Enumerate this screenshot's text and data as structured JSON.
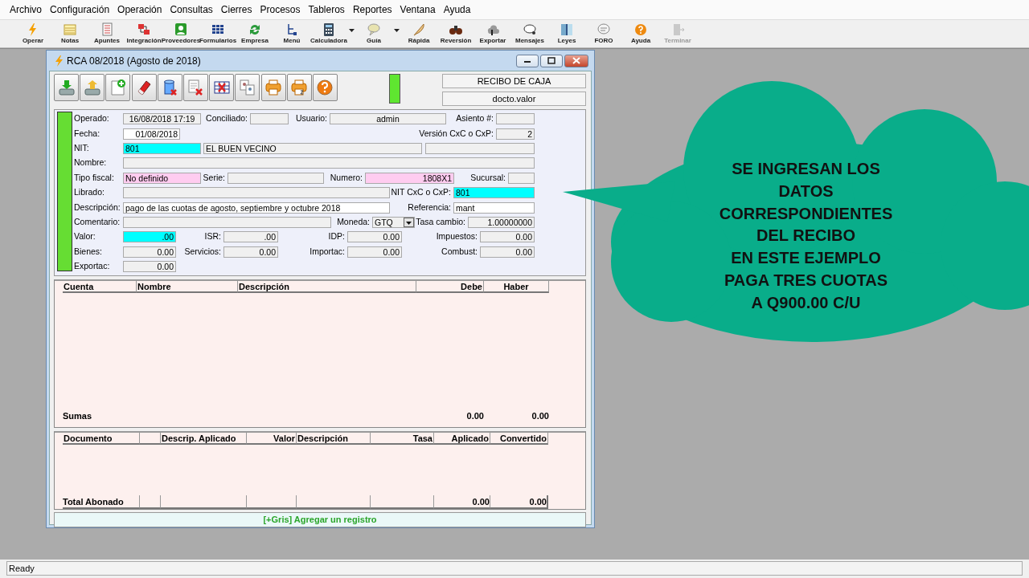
{
  "menu": [
    "Archivo",
    "Configuración",
    "Operación",
    "Consultas",
    "Cierres",
    "Procesos",
    "Tableros",
    "Reportes",
    "Ventana",
    "Ayuda"
  ],
  "toolbar": [
    {
      "label": "Operar",
      "dropdown": false,
      "disabled": false
    },
    {
      "label": "Notas",
      "dropdown": false,
      "disabled": false
    },
    {
      "label": "Apuntes",
      "dropdown": false,
      "disabled": false
    },
    {
      "label": "Integración",
      "dropdown": false,
      "disabled": false
    },
    {
      "label": "Proveedores",
      "dropdown": false,
      "disabled": false
    },
    {
      "label": "Formularios",
      "dropdown": false,
      "disabled": false
    },
    {
      "label": "Empresa",
      "dropdown": false,
      "disabled": false
    },
    {
      "label": "Menú",
      "dropdown": false,
      "disabled": false
    },
    {
      "label": "Calculadora",
      "dropdown": true,
      "disabled": false
    },
    {
      "label": "Guía",
      "dropdown": true,
      "disabled": false
    },
    {
      "label": "Rápida",
      "dropdown": false,
      "disabled": false
    },
    {
      "label": "Reversión",
      "dropdown": false,
      "disabled": false
    },
    {
      "label": "Exportar",
      "dropdown": false,
      "disabled": false
    },
    {
      "label": "Mensajes",
      "dropdown": false,
      "disabled": false
    },
    {
      "label": "Leyes",
      "dropdown": false,
      "disabled": false
    },
    {
      "label": "FORO",
      "dropdown": false,
      "disabled": false
    },
    {
      "label": "Ayuda",
      "dropdown": false,
      "disabled": false
    },
    {
      "label": "Terminar",
      "dropdown": false,
      "disabled": true
    }
  ],
  "window": {
    "title": "RCA 08/2018 (Agosto de 2018)",
    "doc_type": "RECIBO DE CAJA",
    "doc_mode": "docto.valor"
  },
  "form": {
    "fields": [
      {
        "label": "Operado:",
        "value": "16/08/2018 17:19",
        "kind": "center",
        "color": "#f0f0f0"
      },
      {
        "label": "Conciliado:",
        "kind": "text",
        "color": "#f0f0f0"
      },
      {
        "label": "Usuario:",
        "value": "admin",
        "kind": "center",
        "color": "#f0f0f0"
      },
      {
        "label": "Asiento #:",
        "kind": "text",
        "color": "#f0f0f0"
      },
      {
        "label": "Fecha:",
        "value": "01/08/2018",
        "kind": "number",
        "color": "#ffffff"
      },
      {
        "label": "Versión CxC o CxP:",
        "value": "2",
        "kind": "number",
        "color": "#f0f0f0"
      },
      {
        "label": "NIT:",
        "value": "801",
        "kind": "text",
        "color": "#00ffff"
      },
      {
        "value": "EL BUEN VECINO",
        "kind": "text",
        "color": "#f0f0f0"
      },
      {
        "kind": "text",
        "color": "#f0f0f0"
      },
      {
        "label": "Nombre:",
        "kind": "text",
        "color": "#f0f0f0"
      },
      {
        "label": "Tipo fiscal:",
        "value": "No definido",
        "kind": "text",
        "color": "#ffccf0"
      },
      {
        "label": "Serie:",
        "kind": "text",
        "color": "#f0f0f0"
      },
      {
        "label": "Numero:",
        "value": "1808X1",
        "kind": "number",
        "color": "#ffccf0"
      },
      {
        "label": "Sucursal:",
        "kind": "text",
        "color": "#f0f0f0"
      },
      {
        "label": "Librado:",
        "kind": "text",
        "color": "#f0f0f0"
      },
      {
        "label": "NIT CxC o CxP:",
        "value": "801",
        "kind": "text",
        "color": "#00ffff"
      },
      {
        "label": "Descripción:",
        "value": "pago de las cuotas de agosto, septiembre y octubre 2018",
        "kind": "text",
        "color": "#ffffff"
      },
      {
        "label": "Referencia:",
        "value": "mant",
        "kind": "text",
        "color": "#ffffff"
      },
      {
        "label": "Comentario:",
        "kind": "text",
        "color": "#f0f0f0"
      },
      {
        "label": "Moneda:",
        "value": "GTQ",
        "kind": "select",
        "color": "#f0f0f0"
      },
      {
        "label": "Tasa cambio:",
        "value": "1.00000000",
        "kind": "number",
        "color": "#f0f0f0"
      },
      {
        "label": "Valor:",
        "value": ".00",
        "kind": "number",
        "color": "#00ffff"
      },
      {
        "label": "ISR:",
        "value": ".00",
        "kind": "number",
        "color": "#f0f0f0"
      },
      {
        "label": "IDP:",
        "value": "0.00",
        "kind": "number",
        "color": "#f0f0f0"
      },
      {
        "label": "Impuestos:",
        "value": "0.00",
        "kind": "number",
        "color": "#f0f0f0"
      },
      {
        "label": "Bienes:",
        "value": "0.00",
        "kind": "number",
        "color": "#f0f0f0"
      },
      {
        "label": "Servicios:",
        "value": "0.00",
        "kind": "number",
        "color": "#f0f0f0"
      },
      {
        "label": "Importac:",
        "value": "0.00",
        "kind": "number",
        "color": "#f0f0f0"
      },
      {
        "label": "Combust:",
        "value": "0.00",
        "kind": "number",
        "color": "#f0f0f0"
      },
      {
        "label": "Exportac:",
        "value": "0.00",
        "kind": "number",
        "color": "#f0f0f0"
      }
    ]
  },
  "accounts_table": {
    "columns": [
      "Cuenta",
      "Nombre",
      "Descripción",
      "Debe",
      "Haber"
    ],
    "totals_label": "Sumas",
    "totals": [
      "0.00",
      "0.00"
    ]
  },
  "applied_table": {
    "columns": [
      "Documento",
      "Descrip. Aplicado",
      "Valor",
      "Descripción",
      "Tasa",
      "Aplicado",
      "Convertido"
    ],
    "totals_label": "Total Abonado",
    "totals": [
      "0.00",
      "0.00"
    ]
  },
  "add_record": "[+Gris] Agregar un registro",
  "callout": {
    "lines": [
      "SE INGRESAN LOS",
      "DATOS",
      "CORRESPONDIENTES",
      "DEL RECIBO",
      "EN ESTE EJEMPLO",
      "PAGA TRES CUOTAS",
      "A Q900.00 C/U"
    ]
  },
  "status_bar": "Ready"
}
